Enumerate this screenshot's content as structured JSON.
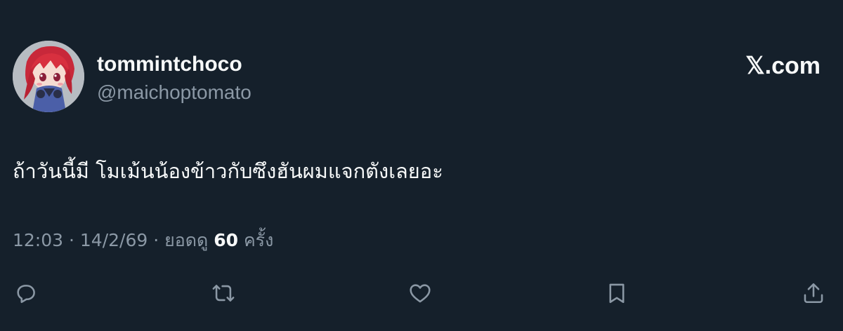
{
  "author": {
    "display_name": "tommintchoco",
    "handle": "@maichoptomato",
    "avatar_icon": "anime-character-avatar"
  },
  "brand": {
    "label": "𝕏.com",
    "icon": "x-logo-icon"
  },
  "tweet": {
    "text": "ถ้าวันนี้มี โมเม้นน้องข้าวกับซึงฮันผมแจกตังเลยอะ"
  },
  "meta": {
    "time": "12:03",
    "separator": " · ",
    "date": "14/2/69",
    "views_label": "ยอดดู",
    "views_count": "60",
    "views_unit": "ครั้ง"
  },
  "actions": [
    {
      "name": "reply",
      "icon": "reply-icon"
    },
    {
      "name": "repost",
      "icon": "repost-icon"
    },
    {
      "name": "like",
      "icon": "heart-icon"
    },
    {
      "name": "bookmark",
      "icon": "bookmark-icon"
    },
    {
      "name": "share",
      "icon": "share-icon"
    }
  ],
  "colors": {
    "background": "#15202b",
    "primary_text": "#f7f9f9",
    "secondary_text": "#8b98a5"
  }
}
